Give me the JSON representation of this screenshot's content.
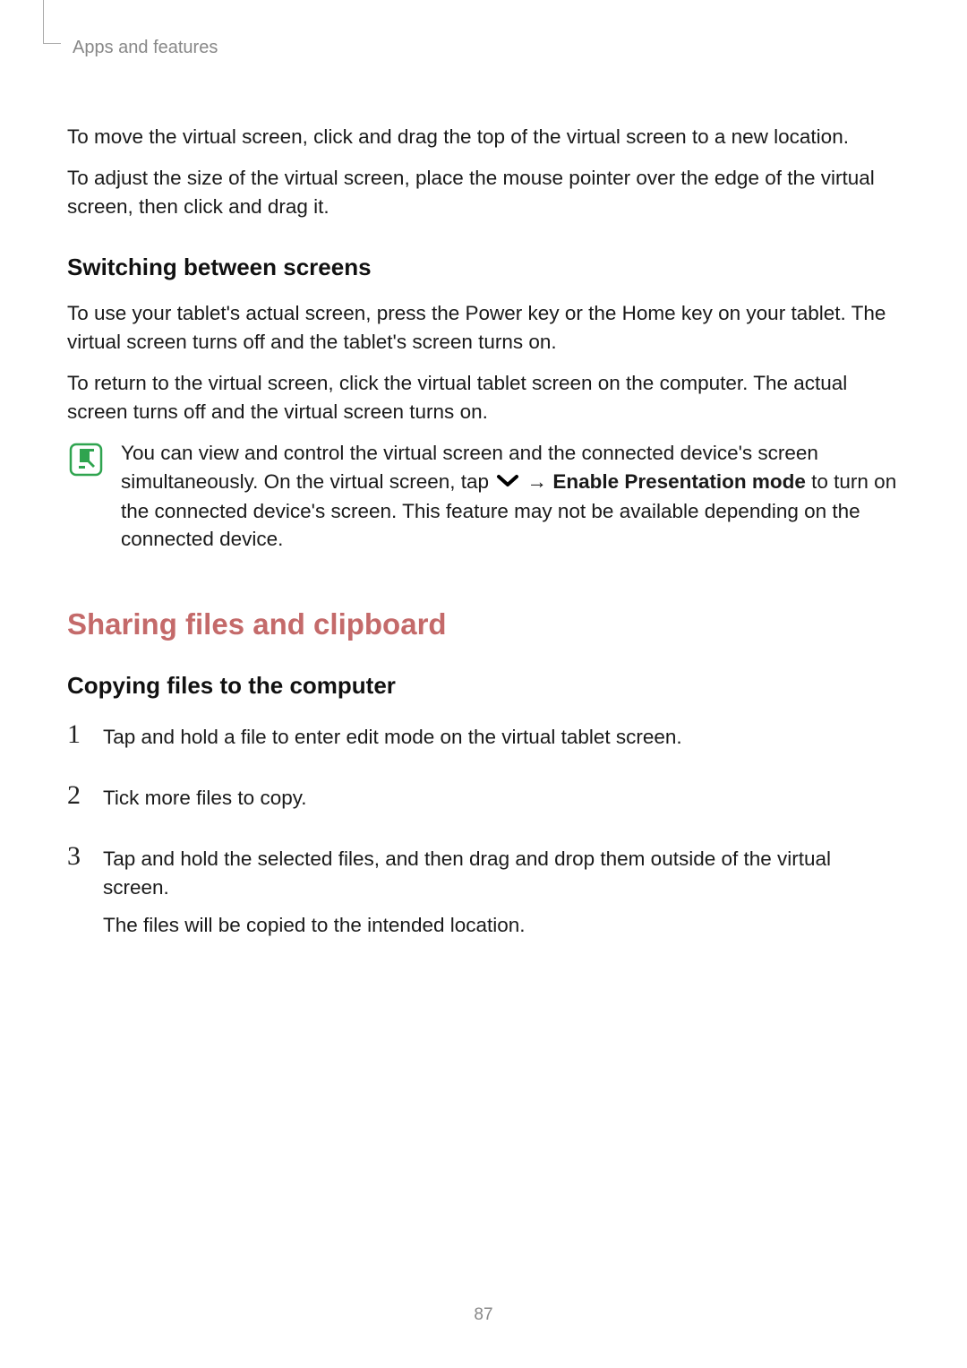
{
  "breadcrumb": "Apps and features",
  "para1": "To move the virtual screen, click and drag the top of the virtual screen to a new location.",
  "para2": "To adjust the size of the virtual screen, place the mouse pointer over the edge of the virtual screen, then click and drag it.",
  "h3_switching": "Switching between screens",
  "para3": "To use your tablet's actual screen, press the Power key or the Home key on your tablet. The virtual screen turns off and the tablet's screen turns on.",
  "para4": "To return to the virtual screen, click the virtual tablet screen on the computer. The actual screen turns off and the virtual screen turns on.",
  "note": {
    "text_before": "You can view and control the virtual screen and the connected device's screen simultaneously. On the virtual screen, tap ",
    "arrow": " → ",
    "bold": "Enable Presentation mode",
    "text_after": " to turn on the connected device's screen. This feature may not be available depending on the connected device."
  },
  "h2_sharing": "Sharing files and clipboard",
  "h3_copying": "Copying files to the computer",
  "steps": [
    {
      "num": "1",
      "lines": [
        "Tap and hold a file to enter edit mode on the virtual tablet screen."
      ]
    },
    {
      "num": "2",
      "lines": [
        "Tick more files to copy."
      ]
    },
    {
      "num": "3",
      "lines": [
        "Tap and hold the selected files, and then drag and drop them outside of the virtual screen.",
        "The files will be copied to the intended location."
      ]
    }
  ],
  "page_number": "87"
}
